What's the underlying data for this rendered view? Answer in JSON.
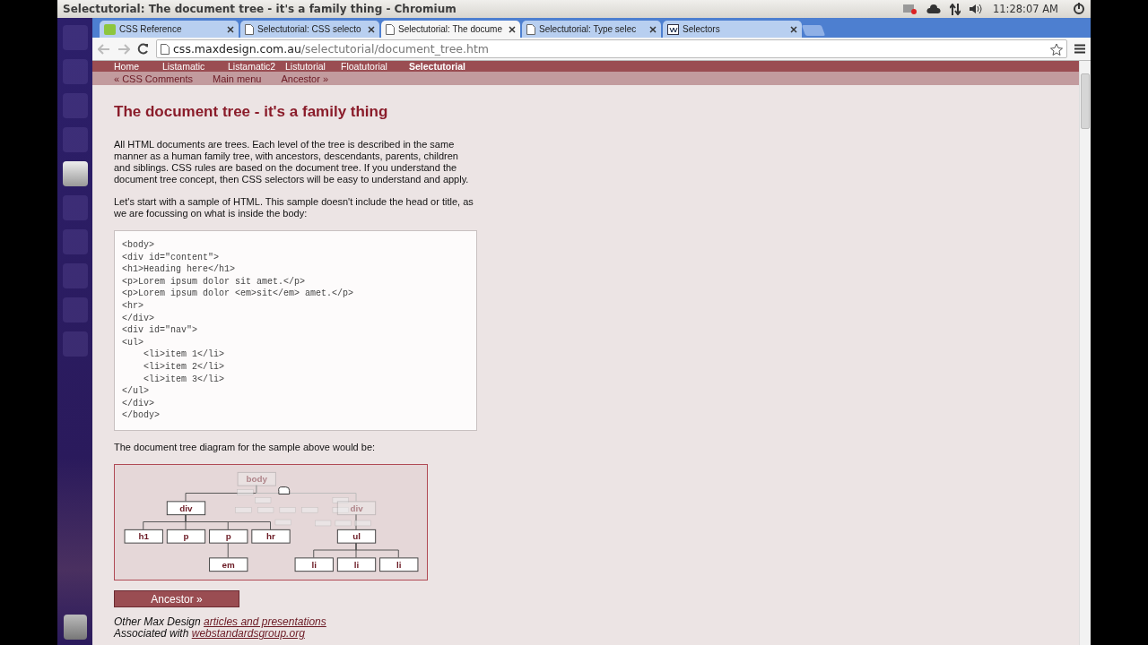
{
  "window": {
    "title": "Selectutorial: The document tree - it's a family thing - Chromium"
  },
  "system_tray": {
    "clock": "11:28:07 AM"
  },
  "tabs": [
    {
      "label": "CSS Reference",
      "kind": "site",
      "selected": false
    },
    {
      "label": "Selectutorial: CSS selecto",
      "kind": "page",
      "selected": false
    },
    {
      "label": "Selectutorial: The docume",
      "kind": "page",
      "selected": true
    },
    {
      "label": "Selectutorial: Type selec",
      "kind": "page",
      "selected": false
    },
    {
      "label": "Selectors",
      "kind": "reference",
      "selected": false
    }
  ],
  "address_bar": {
    "host": "css.maxdesign.com.au",
    "path": "/selectutorial/document_tree.htm"
  },
  "site_nav": [
    {
      "label": "Home",
      "selected": false
    },
    {
      "label": "Listamatic",
      "selected": false
    },
    {
      "label": "Listamatic2",
      "selected": false
    },
    {
      "label": "Listutorial",
      "selected": false
    },
    {
      "label": "Floatutorial",
      "selected": false
    },
    {
      "label": "Selectutorial",
      "selected": true
    }
  ],
  "sub_nav": [
    "« CSS Comments",
    "Main menu",
    "Ancestor »"
  ],
  "heading": "The document tree - it's a family thing",
  "paragraphs": [
    "All HTML documents are trees. Each level of the tree is described in the same manner as a human family tree, with ancestors, descendants, parents, children and siblings. CSS rules are based on the document tree. If you understand the document tree concept, then CSS selectors will be easy to understand and apply.",
    "Let's start with a sample of HTML. This sample doesn't include the head or title, as we are focussing on what is inside the body:"
  ],
  "code_sample": [
    "<body>",
    "<div id=\"content\">",
    "<h1>Heading here</h1>",
    "<p>Lorem ipsum dolor sit amet.</p>",
    "<p>Lorem ipsum dolor <em>sit</em> amet.</p>",
    "<hr>",
    "</div>",
    "<div id=\"nav\">",
    "<ul>",
    "    <li>item 1</li>",
    "    <li>item 2</li>",
    "    <li>item 3</li>",
    "</ul>",
    "</div>",
    "</body>"
  ],
  "diagram_caption": "The document tree diagram for the sample above would be:",
  "diagram": {
    "label": "body",
    "faded": true,
    "children": [
      {
        "label": "div",
        "faded": false,
        "children": [
          {
            "label": "h1",
            "faded": false
          },
          {
            "label": "p",
            "faded": false
          },
          {
            "label": "p",
            "faded": false,
            "children": [
              {
                "label": "em",
                "faded": false
              }
            ]
          },
          {
            "label": "hr",
            "faded": false
          }
        ]
      },
      {
        "label": "div",
        "faded": true,
        "children": [
          {
            "label": "ul",
            "faded": false,
            "children": [
              {
                "label": "li",
                "faded": false
              },
              {
                "label": "li",
                "faded": false
              },
              {
                "label": "li",
                "faded": false
              }
            ]
          }
        ]
      }
    ]
  },
  "next_button": "Ancestor »",
  "footer": [
    {
      "text": "Other Max Design ",
      "link": "articles and presentations"
    },
    {
      "text": "Associated with ",
      "link": "webstandardsgroup.org"
    }
  ]
}
